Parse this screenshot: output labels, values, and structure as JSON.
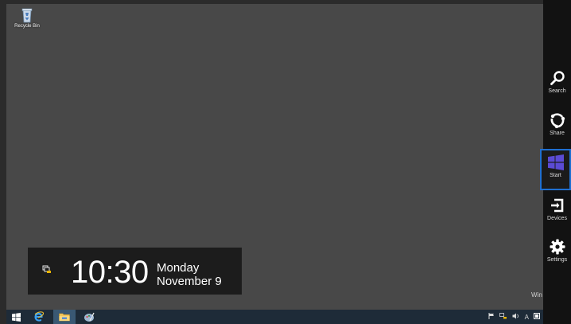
{
  "desktop": {
    "icons": [
      {
        "label": "Recycle Bin",
        "icon": "recycle-bin-icon"
      }
    ],
    "watermark": "Win"
  },
  "clock": {
    "time": "10:30",
    "day": "Monday",
    "date": "November 9",
    "status_icon": "network-icon"
  },
  "charms": [
    {
      "label": "Search",
      "icon": "search-icon"
    },
    {
      "label": "Share",
      "icon": "share-icon"
    },
    {
      "label": "Start",
      "icon": "windows-logo-icon",
      "selected": true
    },
    {
      "label": "Devices",
      "icon": "devices-icon"
    },
    {
      "label": "Settings",
      "icon": "gear-icon"
    }
  ],
  "taskbar": {
    "items": [
      {
        "icon": "start-button-icon"
      },
      {
        "icon": "internet-explorer-icon"
      },
      {
        "icon": "file-explorer-icon",
        "active": true
      },
      {
        "icon": "paint-icon"
      }
    ],
    "tray_input_indicator": "A"
  },
  "colors": {
    "desktop_bg": "#484848",
    "charm_bar": "#121212",
    "selection_border": "#1f6fd1",
    "taskbar": "#1e2b38",
    "windows_logo": "#5b4bd4"
  }
}
